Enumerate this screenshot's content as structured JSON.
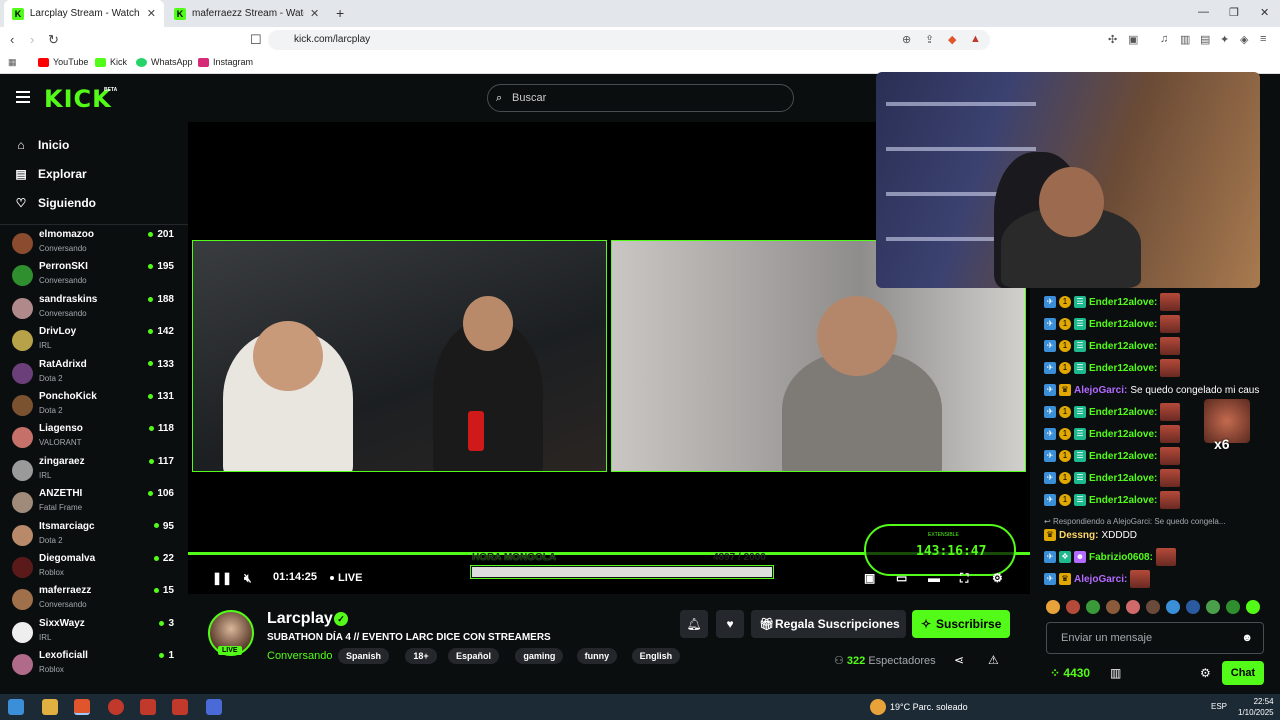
{
  "browser": {
    "tabs": [
      {
        "title": "Larcplay Stream - Watch Live on",
        "active": true
      },
      {
        "title": "maferraezz Stream - Watch Live on K",
        "active": false
      }
    ],
    "url": "kick.com/larcplay",
    "bookmarks": [
      "YouTube",
      "Kick",
      "WhatsApp",
      "Instagram"
    ]
  },
  "header": {
    "logo": "KICK",
    "logo_badge": "BETA",
    "search_placeholder": "Buscar"
  },
  "sidebar": {
    "nav": [
      {
        "label": "Inicio",
        "icon": "home-icon"
      },
      {
        "label": "Explorar",
        "icon": "compass-icon"
      },
      {
        "label": "Siguiendo",
        "icon": "heart-icon"
      }
    ],
    "channels": [
      {
        "name": "elmomazoo",
        "category": "Conversando",
        "viewers": "201",
        "color": "#8a4b2e"
      },
      {
        "name": "PerronSKI",
        "category": "Conversando",
        "viewers": "195",
        "color": "#2f8f2f"
      },
      {
        "name": "sandraskins",
        "category": "Conversando",
        "viewers": "188",
        "color": "#b08a8a"
      },
      {
        "name": "DrivLoy",
        "category": "IRL",
        "viewers": "142",
        "color": "#b7a24a"
      },
      {
        "name": "RatAdrixd",
        "category": "Dota 2",
        "viewers": "133",
        "color": "#6b3f7a"
      },
      {
        "name": "PonchoKick",
        "category": "Dota 2",
        "viewers": "131",
        "color": "#7a5230"
      },
      {
        "name": "Liagenso",
        "category": "VALORANT",
        "viewers": "118",
        "color": "#c5716a"
      },
      {
        "name": "zingaraez",
        "category": "IRL",
        "viewers": "117",
        "color": "#9a9a9a"
      },
      {
        "name": "ANZETHI",
        "category": "Fatal Frame",
        "viewers": "106",
        "color": "#a08a7a"
      },
      {
        "name": "Itsmarciagc",
        "category": "Dota 2",
        "viewers": "95",
        "color": "#b88a6a"
      },
      {
        "name": "Diegomalva",
        "category": "Roblox",
        "viewers": "22",
        "color": "#5a1a1a"
      },
      {
        "name": "maferraezz",
        "category": "Conversando",
        "viewers": "15",
        "color": "#a0704a"
      },
      {
        "name": "SixxWayz",
        "category": "IRL",
        "viewers": "3",
        "color": "#eeeeee"
      },
      {
        "name": "Lexoficiall",
        "category": "Roblox",
        "viewers": "1",
        "color": "#b06a8a"
      }
    ]
  },
  "player": {
    "time": "01:14:25",
    "live_label": "LIVE",
    "goal_label": "HORA MONGOLA",
    "goal_count": "4897 / 2000",
    "goal_progress": 1.0,
    "timer_label": "EXTENSIBLE",
    "timer": "143:16:47"
  },
  "channel": {
    "name": "Larcplay",
    "live_badge": "LIVE",
    "title": "SUBATHON DÍA 4 // EVENTO LARC DICE CON STREAMERS",
    "category": "Conversando",
    "tags": [
      "Spanish",
      "18+",
      "Español",
      "gaming",
      "funny",
      "English"
    ],
    "gift_label": "Regala Suscripciones",
    "subscribe_label": "Suscribirse",
    "viewers_count": "322",
    "viewers_label": "Espectadores"
  },
  "chat": {
    "messages": [
      {
        "user": "Ender12alove:",
        "text": "",
        "color": "#53fc18",
        "badge": "gift",
        "emote": true
      },
      {
        "user": "Ender12alove:",
        "text": "",
        "color": "#53fc18",
        "badge": "gift",
        "emote": true
      },
      {
        "user": "Ender12alove:",
        "text": "",
        "color": "#53fc18",
        "badge": "gift",
        "emote": true
      },
      {
        "user": "Ender12alove:",
        "text": "",
        "color": "#53fc18",
        "badge": "gift",
        "emote": true
      },
      {
        "user": "AlejoGarci:",
        "text": "Se quedo congelado mi caus",
        "color": "#b36bff",
        "badge": "crown",
        "emote": false
      },
      {
        "user": "Ender12alove:",
        "text": "",
        "color": "#53fc18",
        "badge": "gift",
        "emote": true
      },
      {
        "user": "Ender12alove:",
        "text": "",
        "color": "#53fc18",
        "badge": "gift",
        "emote": true
      },
      {
        "user": "Ender12alove:",
        "text": "",
        "color": "#53fc18",
        "badge": "gift",
        "emote": true
      },
      {
        "user": "Ender12alove:",
        "text": "",
        "color": "#53fc18",
        "badge": "gift",
        "emote": true
      },
      {
        "user": "Ender12alove:",
        "text": "",
        "color": "#53fc18",
        "badge": "gift",
        "emote": true
      }
    ],
    "reply_hint": "Respondiendo a AlejoGarci: Se quedo congela...",
    "reply_msg": {
      "user": "Dessng:",
      "text": "XDDDD",
      "color": "#ffd966"
    },
    "msg_fabrizio": {
      "user": "Fabrizio0608:",
      "color": "#53fc18"
    },
    "msg_alejo": {
      "user": "AlejoGarci:",
      "color": "#b36bff"
    },
    "big_emote_count": "x6",
    "input_placeholder": "Enviar un mensaje",
    "points": "4430",
    "chat_button": "Chat"
  },
  "taskbar": {
    "weather": "19°C  Parc. soleado",
    "lang": "ESP",
    "time": "22:54",
    "date": "1/10/2025"
  }
}
